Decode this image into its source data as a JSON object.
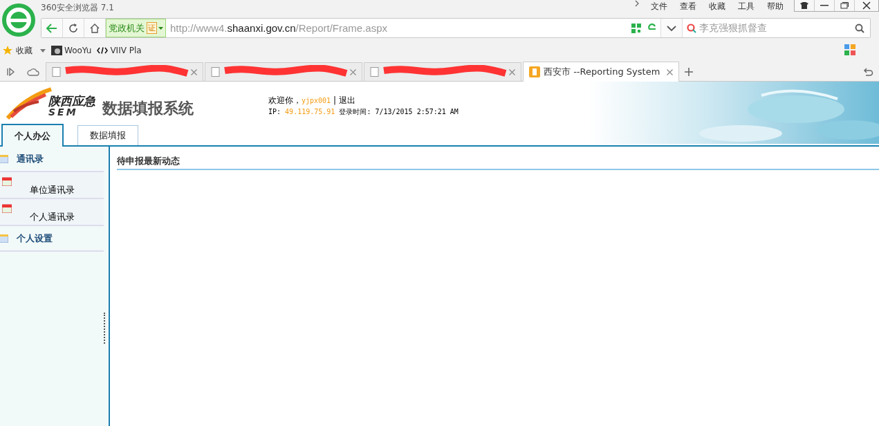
{
  "browser": {
    "title": "360安全浏览器 7.1",
    "menu": [
      "文件",
      "查看",
      "收藏",
      "工具",
      "帮助"
    ],
    "address": {
      "badge": "党政机关",
      "badge_mark": "证",
      "url_prefix": "http://www4.",
      "url_domain": "shaanxi.gov.cn",
      "url_path": "/Report/Frame.aspx"
    },
    "search": {
      "placeholder": "李克强狠抓督查"
    },
    "bookmarks": [
      {
        "label": "收藏",
        "kind": "favorites"
      },
      {
        "label": "WooYu",
        "kind": "site"
      },
      {
        "label": "VIIV Pla",
        "kind": "code"
      }
    ],
    "tabs": [
      {
        "selected": false,
        "redacted": true
      },
      {
        "selected": false,
        "redacted": true
      },
      {
        "selected": false,
        "redacted": true
      },
      {
        "label": "西安市 --Reporting System",
        "selected": true,
        "redacted": false
      }
    ]
  },
  "page": {
    "logo": {
      "name": "陕西应急",
      "abbr": "SEM"
    },
    "system_title": "数据填报系统",
    "welcome": "欢迎你，",
    "user": "yjpx001",
    "separator": "|",
    "logout": "退出",
    "ip_label": "IP:",
    "ip": "49.119.75.91",
    "login_label": "登录时间:",
    "login_time": "7/13/2015 2:57:21 AM",
    "nav_tabs": [
      {
        "label": "个人办公",
        "selected": true
      },
      {
        "label": "数据填报",
        "selected": false
      }
    ],
    "sidebar": [
      {
        "label": "通讯录",
        "kind": "group"
      },
      {
        "label": "单位通讯录",
        "kind": "item"
      },
      {
        "label": "个人通讯录",
        "kind": "item"
      },
      {
        "label": "个人设置",
        "kind": "group"
      }
    ],
    "section_title": "待申报最新动态"
  }
}
